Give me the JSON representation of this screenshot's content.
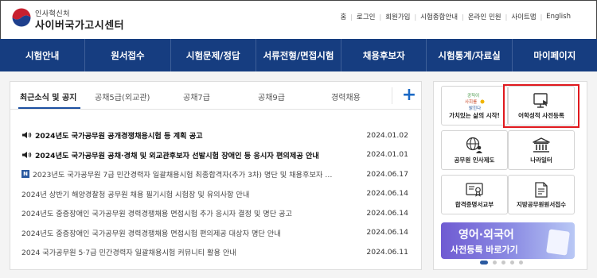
{
  "header": {
    "org_name": "인사혁신처",
    "site_name": "사이버국가고시센터",
    "util_links": [
      "홈",
      "로그인",
      "회원가입",
      "시험종합안내",
      "온라인 민원",
      "사이트맵",
      "English"
    ]
  },
  "gnb": [
    "시험안내",
    "원서접수",
    "시험문제/정답",
    "서류전형/면접시험",
    "채용후보자",
    "시험통계/자료실",
    "마이페이지"
  ],
  "news": {
    "tabs": [
      "최근소식 및 공지",
      "공채5급(외교관)",
      "공채7급",
      "공채9급",
      "경력채용"
    ],
    "plus_label": "+",
    "items": [
      {
        "title": "2024년도 국가공무원 공개경쟁채용시험 등 계획 공고",
        "date": "2024.01.02",
        "type": "notice"
      },
      {
        "title": "2024년도 국가공무원 공채·경채 및 외교관후보자 선발시험 장애인 등 응시자 편의제공 안내",
        "date": "2024.01.01",
        "type": "notice"
      },
      {
        "title": "2023년도 국가공무원 7급 민간경력자 일괄채용시험 최종합격자(추가 3차) 명단 및 채용후보자 …",
        "date": "2024.06.17",
        "type": "new"
      },
      {
        "title": "2024년 상반기 해양경찰청 공무원 채용 필기시험 시험장 및 유의사항 안내",
        "date": "2024.06.14",
        "type": "normal"
      },
      {
        "title": "2024년도 중증장애인 국가공무원 경력경쟁채용 면접시험 추가 응시자 결정 및 명단 공고",
        "date": "2024.06.14",
        "type": "normal"
      },
      {
        "title": "2024년도 중증장애인 국가공무원 경력경쟁채용 면접시험 편의제공 대상자 명단 안내",
        "date": "2024.06.14",
        "type": "normal"
      },
      {
        "title": "2024 국가공무원 5·7급 민간경력자 일괄채용시험 커뮤니티 활용 안내",
        "date": "2024.06.11",
        "type": "normal"
      }
    ],
    "new_badge": "N"
  },
  "quick": {
    "buttons": [
      {
        "label": "가치있는 삶의 시작!",
        "icon": "value-logo-icon"
      },
      {
        "label": "어학성적 사전등록",
        "icon": "monitor-pointer-icon"
      },
      {
        "label": "공무원 인사제도",
        "icon": "globe-person-icon"
      },
      {
        "label": "나라일터",
        "icon": "government-building-icon"
      },
      {
        "label": "합격증명서교부",
        "icon": "certificate-icon"
      },
      {
        "label": "지방공무원원서접수",
        "icon": "document-icon"
      }
    ],
    "value_logo_text": [
      "공직이",
      "사회를",
      "밝힌다"
    ],
    "banner": {
      "line1": "영어·외국어",
      "line2": "사전등록 바로가기"
    }
  },
  "colors": {
    "gnb_bg": "#163d80",
    "accent": "#1b4fa0",
    "highlight": "#e0191e",
    "plus": "#1b69c5"
  }
}
